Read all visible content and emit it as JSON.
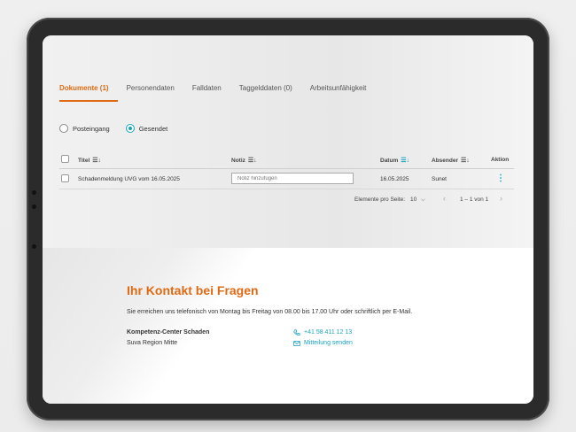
{
  "tabs": [
    {
      "label": "Dokumente (1)",
      "active": true
    },
    {
      "label": "Personendaten",
      "active": false
    },
    {
      "label": "Falldaten",
      "active": false
    },
    {
      "label": "Taggelddaten (0)",
      "active": false
    },
    {
      "label": "Arbeitsunfähigkeit",
      "active": false
    }
  ],
  "filter": {
    "inbox_label": "Posteingang",
    "sent_label": "Gesendet",
    "selected": "Gesendet"
  },
  "table": {
    "columns": {
      "title": "Titel",
      "note": "Notiz",
      "date": "Datum",
      "sender": "Absender",
      "action": "Aktion"
    },
    "rows": [
      {
        "title": "Schadenmeldung UVG vom 16.05.2025",
        "note_placeholder": "Notiz hinzufügen",
        "date": "16.05.2025",
        "sender": "Sunet"
      }
    ]
  },
  "pagination": {
    "per_page_label": "Elemente pro Seite:",
    "per_page_value": "10",
    "range": "1 – 1 von 1"
  },
  "contact": {
    "title": "Ihr Kontakt bei Fragen",
    "text": "Sie erreichen uns telefonisch von Montag bis Freitag von 08.00 bis 17.00 Uhr oder schriftlich per E-Mail.",
    "center_name": "Kompetenz-Center Schaden",
    "region": "Suva Region Mitte",
    "phone": "+41 58 411 12 13",
    "message_label": "Mitteilung senden"
  },
  "colors": {
    "accent_orange": "#e06a13",
    "accent_teal": "#1aa3c1"
  }
}
